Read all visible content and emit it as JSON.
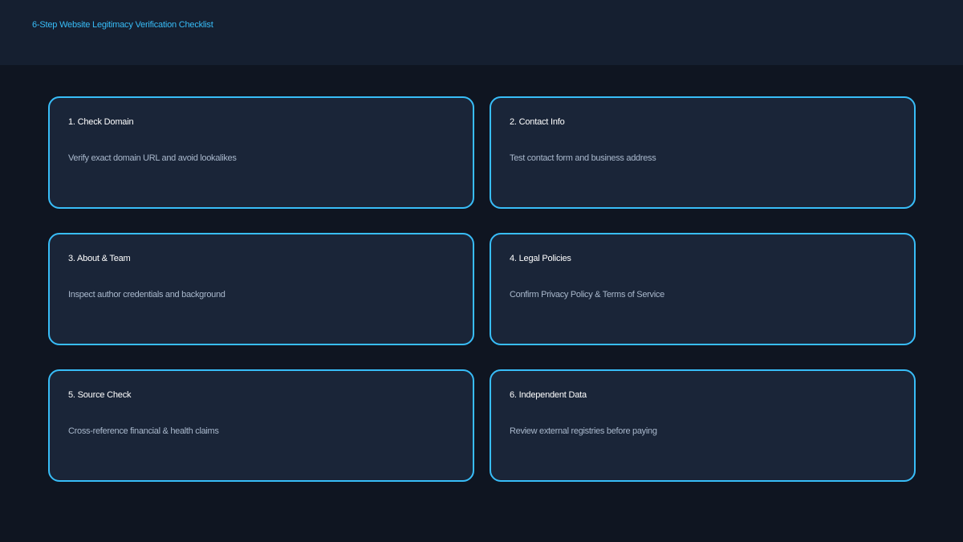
{
  "header": {
    "title": "6-Step Website Legitimacy Verification Checklist"
  },
  "colors": {
    "background": "#0f1521",
    "header_background": "#151f30",
    "card_background": "#1a2538",
    "accent": "#38bdf8",
    "title_text": "#ffffff",
    "body_text": "#a9b8cc"
  },
  "steps": [
    {
      "title": "1. Check Domain",
      "description": "Verify exact domain URL and avoid lookalikes"
    },
    {
      "title": "2. Contact Info",
      "description": "Test contact form and business address"
    },
    {
      "title": "3. About & Team",
      "description": "Inspect author credentials and background"
    },
    {
      "title": "4. Legal Policies",
      "description": "Confirm Privacy Policy & Terms of Service"
    },
    {
      "title": "5. Source Check",
      "description": "Cross-reference financial & health claims"
    },
    {
      "title": "6. Independent Data",
      "description": "Review external registries before paying"
    }
  ]
}
